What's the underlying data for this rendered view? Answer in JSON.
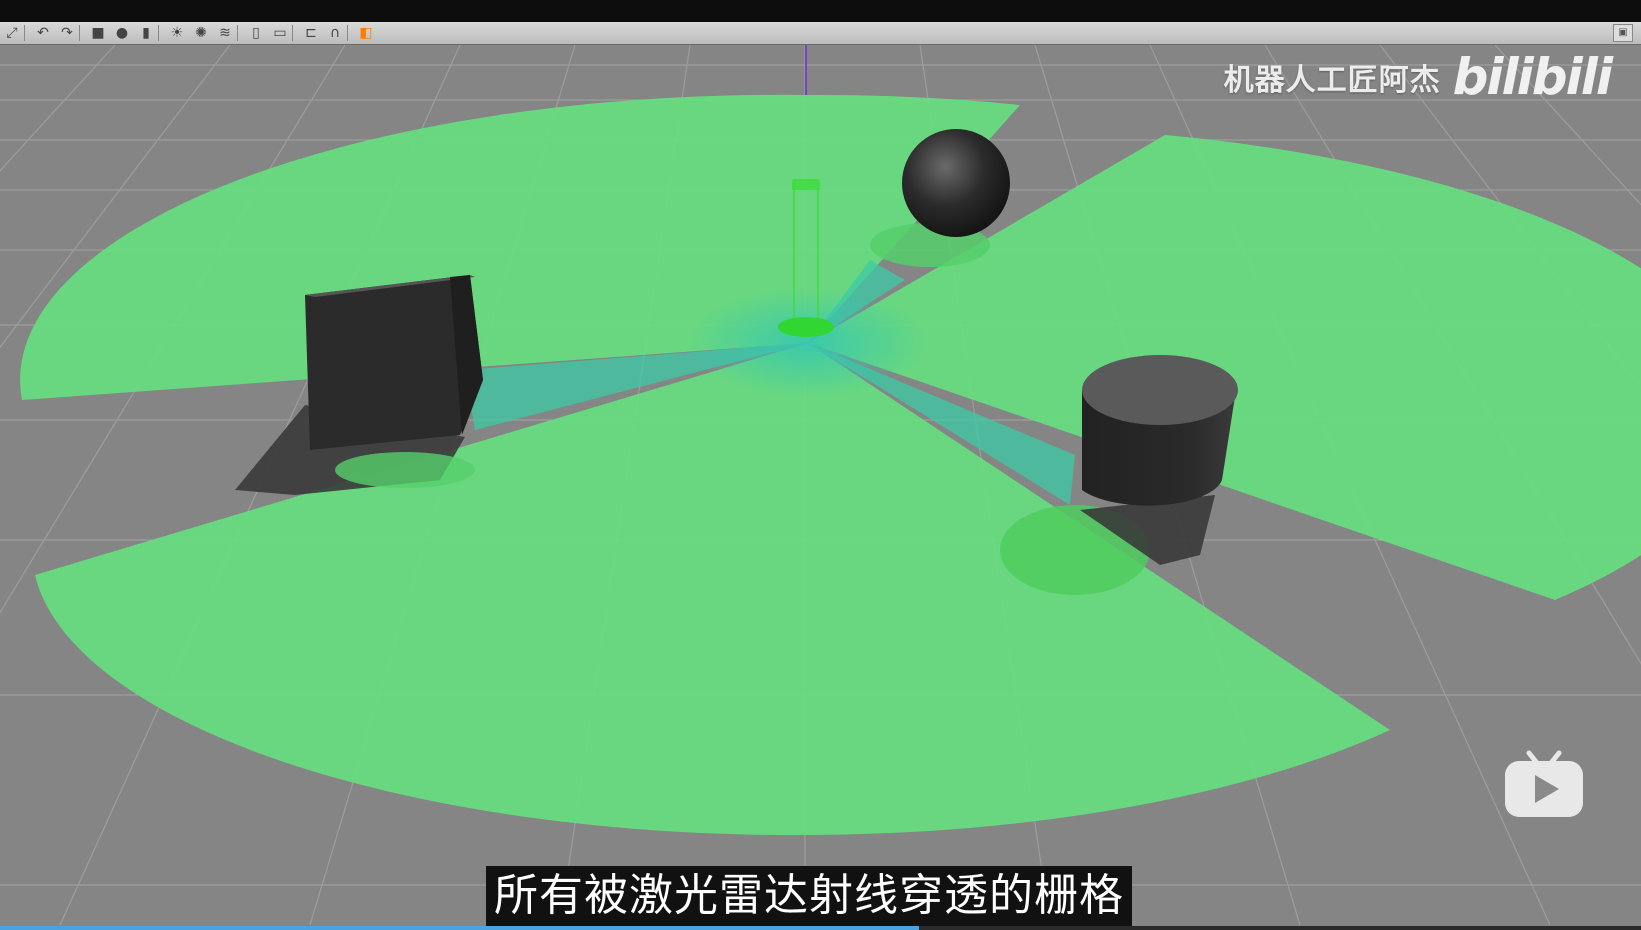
{
  "video": {
    "watermark_author": "机器人工匠阿杰",
    "watermark_logo": "bilibili",
    "subtitle": "所有被激光雷达射线穿透的栅格",
    "progress_fraction": 0.56
  },
  "toolbar": {
    "icons": [
      "select-icon",
      "undo-icon",
      "redo-icon",
      "box-icon",
      "sphere-icon",
      "cylinder-icon",
      "sun-icon",
      "spot-light-icon",
      "directional-light-icon",
      "copy-icon",
      "paste-icon",
      "align-icon",
      "magnet-icon",
      "color-icon"
    ]
  },
  "scene": {
    "floor_color": "#858585",
    "grid_color": "#a0a0a0",
    "laser_color": "#66e07f",
    "obstacle_color": "#2b2b2b",
    "obstacles": [
      "box",
      "sphere",
      "cylinder"
    ]
  },
  "colors": {
    "accent": "#ff7a00",
    "subtitle_bg": "#111111",
    "progress": "#4aa3e0"
  }
}
